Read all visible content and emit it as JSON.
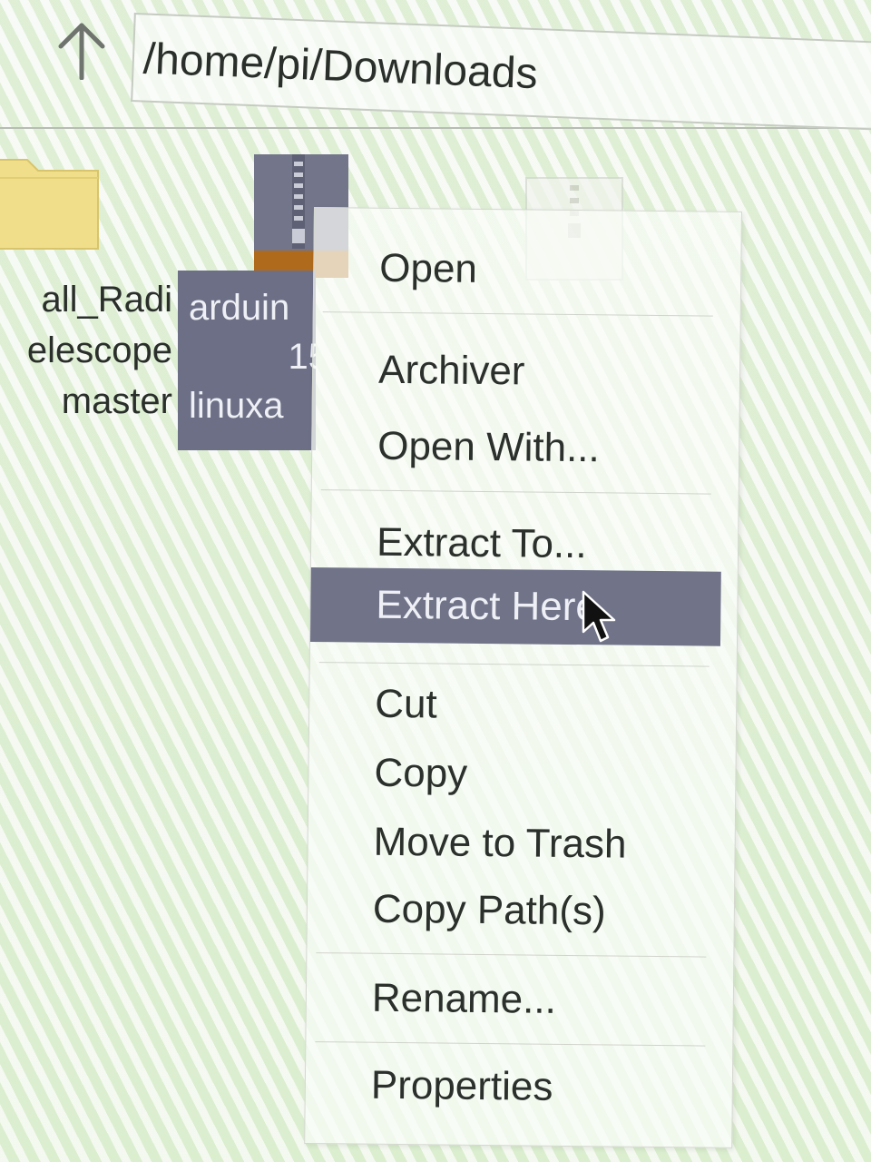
{
  "toolbar": {
    "up_icon": "arrow-up-icon",
    "path": "/home/pi/Downloads"
  },
  "files": {
    "folder": {
      "icon": "folder-icon",
      "label_lines": [
        "all_Radi",
        "elescope",
        "master"
      ]
    },
    "archive": {
      "icon": "zip-archive-icon",
      "label_lines": [
        "arduin",
        "15",
        "linuxa"
      ]
    },
    "third": {
      "icon": "zip-archive-icon"
    }
  },
  "context_menu": {
    "items": {
      "open": "Open",
      "archiver": "Archiver",
      "open_with": "Open With...",
      "extract_to": "Extract To...",
      "extract_here": "Extract Here",
      "cut": "Cut",
      "copy": "Copy",
      "move_to_trash": "Move to Trash",
      "copy_paths": "Copy Path(s)",
      "rename": "Rename...",
      "properties": "Properties"
    },
    "highlighted": "extract_here"
  },
  "colors": {
    "selection": "#717389",
    "folder": "#f0de8a",
    "text": "#2c302c"
  }
}
